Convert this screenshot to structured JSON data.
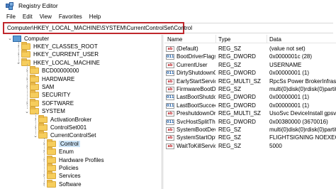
{
  "window": {
    "title": "Registry Editor"
  },
  "menu": [
    "File",
    "Edit",
    "View",
    "Favorites",
    "Help"
  ],
  "address": {
    "path": "Computer\\HKEY_LOCAL_MACHINE\\SYSTEM\\CurrentControlSet\\Control"
  },
  "tree": [
    {
      "label": "Computer",
      "level": 0,
      "icon": "computer-icon",
      "expanded": true
    },
    {
      "label": "HKEY_CLASSES_ROOT",
      "level": 1,
      "icon": "folder-icon",
      "expanded": false
    },
    {
      "label": "HKEY_CURRENT_USER",
      "level": 1,
      "icon": "folder-icon",
      "expanded": false
    },
    {
      "label": "HKEY_LOCAL_MACHINE",
      "level": 1,
      "icon": "folder-icon",
      "expanded": true
    },
    {
      "label": "BCD00000000",
      "level": 2,
      "icon": "folder-icon",
      "expanded": false
    },
    {
      "label": "HARDWARE",
      "level": 2,
      "icon": "folder-icon",
      "expanded": false
    },
    {
      "label": "SAM",
      "level": 2,
      "icon": "folder-icon",
      "expanded": false
    },
    {
      "label": "SECURITY",
      "level": 2,
      "icon": "folder-icon",
      "expanded": null
    },
    {
      "label": "SOFTWARE",
      "level": 2,
      "icon": "folder-icon",
      "expanded": false
    },
    {
      "label": "SYSTEM",
      "level": 2,
      "icon": "folder-icon",
      "expanded": true
    },
    {
      "label": "ActivationBroker",
      "level": 3,
      "icon": "folder-icon",
      "expanded": false
    },
    {
      "label": "ControlSet001",
      "level": 3,
      "icon": "folder-icon",
      "expanded": false
    },
    {
      "label": "CurrentControlSet",
      "level": 3,
      "icon": "folder-icon",
      "expanded": true
    },
    {
      "label": "Control",
      "level": 4,
      "icon": "folder-icon",
      "expanded": false,
      "selected": true
    },
    {
      "label": "Enum",
      "level": 4,
      "icon": "folder-icon",
      "expanded": false
    },
    {
      "label": "Hardware Profiles",
      "level": 4,
      "icon": "folder-icon",
      "expanded": false
    },
    {
      "label": "Policies",
      "level": 4,
      "icon": "folder-icon",
      "expanded": null
    },
    {
      "label": "Services",
      "level": 4,
      "icon": "folder-icon",
      "expanded": false
    },
    {
      "label": "Software",
      "level": 4,
      "icon": "folder-icon",
      "expanded": false
    }
  ],
  "values_table": {
    "columns": [
      "Name",
      "Type",
      "Data"
    ],
    "rows": [
      {
        "name": "(Default)",
        "type": "REG_SZ",
        "data": "(value not set)",
        "icon": "string-value-icon"
      },
      {
        "name": "BootDriverFlags",
        "type": "REG_DWORD",
        "data": "0x0000001c (28)",
        "icon": "binary-value-icon"
      },
      {
        "name": "CurrentUser",
        "type": "REG_SZ",
        "data": "USERNAME",
        "icon": "string-value-icon"
      },
      {
        "name": "DirtyShutdownC...",
        "type": "REG_DWORD",
        "data": "0x00000001 (1)",
        "icon": "binary-value-icon"
      },
      {
        "name": "EarlyStartServices",
        "type": "REG_MULTI_SZ",
        "data": "RpcSs Power BrokerInfrastr",
        "icon": "string-value-icon"
      },
      {
        "name": "FirmwareBootD...",
        "type": "REG_SZ",
        "data": "multi(0)disk(0)rdisk(0)partiti",
        "icon": "string-value-icon"
      },
      {
        "name": "LastBootShutdo",
        "type": "REG_DWORD",
        "data": "0x00000001 (1)",
        "icon": "binary-value-icon"
      },
      {
        "name": "LastBootSuccee",
        "type": "REG_DWORD",
        "data": "0x00000001 (1)",
        "icon": "binary-value-icon"
      },
      {
        "name": "PreshutdownOr",
        "type": "REG_MULTI_SZ",
        "data": "UsoSvc DeviceInstall gpsvc",
        "icon": "string-value-icon"
      },
      {
        "name": "SvcHostSplitThr...",
        "type": "REG_DWORD",
        "data": "0x00380000 (3670016)",
        "icon": "binary-value-icon"
      },
      {
        "name": "SystemBootDevi",
        "type": "REG_SZ",
        "data": "multi(0)disk(0)rdisk(0)partiti",
        "icon": "string-value-icon"
      },
      {
        "name": "SystemStartOpti",
        "type": "REG_SZ",
        "data": "FLIGHTSIGNING NOEXECU",
        "icon": "string-value-icon"
      },
      {
        "name": "WaitToKillServic...",
        "type": "REG_SZ",
        "data": "5000",
        "icon": "string-value-icon"
      }
    ]
  },
  "colors": {
    "highlight_border": "#c0282d",
    "selection": "#cce4f7",
    "folder": "#f6cd5c"
  }
}
